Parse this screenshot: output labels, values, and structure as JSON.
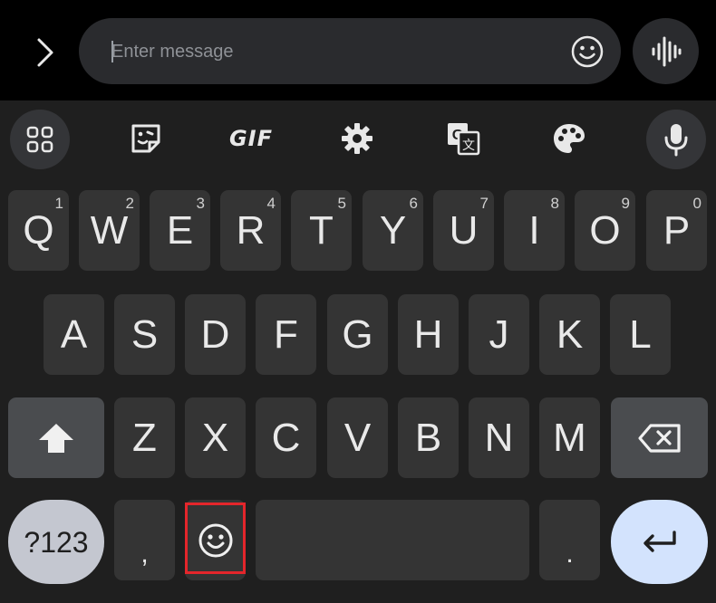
{
  "message_bar": {
    "expand_icon": "chevron-right-icon",
    "placeholder": "Enter message",
    "emoji_icon": "smiley-icon",
    "voice_icon": "voice-waveform-icon"
  },
  "toolbar": {
    "items": [
      {
        "name": "apps-grid-icon"
      },
      {
        "name": "sticker-icon"
      },
      {
        "name": "gif-icon",
        "label": "GIF"
      },
      {
        "name": "settings-gear-icon"
      },
      {
        "name": "translate-icon"
      },
      {
        "name": "theme-palette-icon"
      },
      {
        "name": "microphone-icon"
      }
    ]
  },
  "keyboard": {
    "row1": [
      {
        "label": "Q",
        "hint": "1"
      },
      {
        "label": "W",
        "hint": "2"
      },
      {
        "label": "E",
        "hint": "3"
      },
      {
        "label": "R",
        "hint": "4"
      },
      {
        "label": "T",
        "hint": "5"
      },
      {
        "label": "Y",
        "hint": "6"
      },
      {
        "label": "U",
        "hint": "7"
      },
      {
        "label": "I",
        "hint": "8"
      },
      {
        "label": "O",
        "hint": "9"
      },
      {
        "label": "P",
        "hint": "0"
      }
    ],
    "row2": [
      "A",
      "S",
      "D",
      "F",
      "G",
      "H",
      "J",
      "K",
      "L"
    ],
    "row3": [
      "Z",
      "X",
      "C",
      "V",
      "B",
      "N",
      "M"
    ],
    "symbols_label": "?123",
    "comma_label": ",",
    "period_label": ".",
    "shift_icon": "shift-arrow-icon",
    "backspace_icon": "backspace-icon",
    "emoji_key_icon": "smiley-icon",
    "enter_icon": "enter-return-icon"
  },
  "colors": {
    "highlight": "#e4262b",
    "enter_bg": "#d3e3fd",
    "symbols_bg": "#c4c7d0"
  }
}
